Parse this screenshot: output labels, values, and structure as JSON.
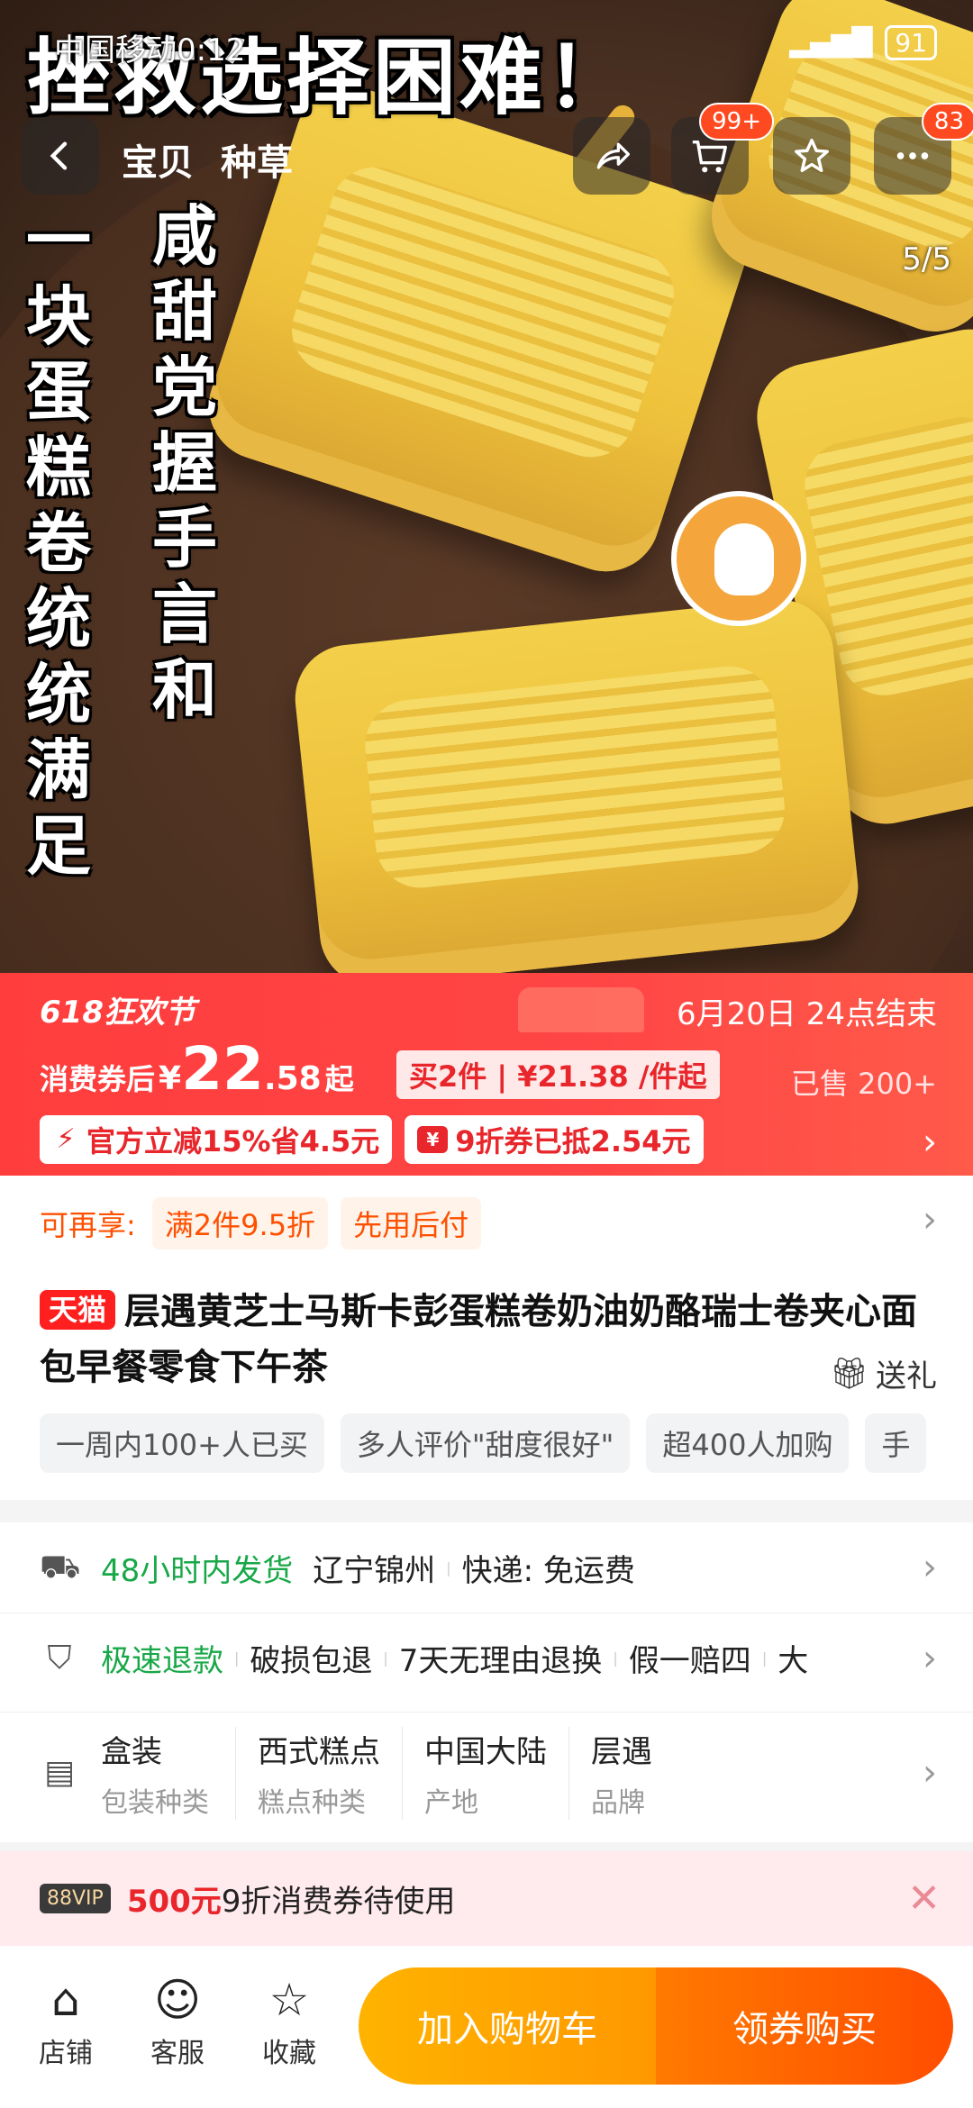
{
  "status_bar": {
    "carrier": "中国移动0:12",
    "battery": "91"
  },
  "hero": {
    "ad_title": "挫救选择困难！",
    "left_vertical": "一块蛋糕卷统统满足",
    "mid_vertical": "咸甜党握手言和",
    "counter": "5/5"
  },
  "nav": {
    "tab_item": "宝贝",
    "tab_grass": "种草",
    "cart_badge": "99+",
    "more_badge": "83"
  },
  "promo": {
    "festival": "618狂欢节",
    "end_time": "6月20日 24点结束",
    "price_label": "消费券后",
    "currency": "¥",
    "price_int": "22",
    "price_dec": ".58",
    "price_suffix": "起",
    "multi_buy": "买2件 | ¥21.38 /件起",
    "sold": "已售 200+",
    "chip_official": "官方立减15%省4.5元",
    "chip_coupon": "9折券已抵2.54元"
  },
  "info": {
    "benefits_label": "可再享:",
    "benefit_1": "满2件9.5折",
    "benefit_2": "先用后付",
    "tmall_tag": "天猫",
    "title": "层遇黄芝士马斯卡彭蛋糕卷奶油奶酪瑞士卷夹心面包早餐零食下午茶",
    "gift": "送礼",
    "social_1": "一周内100+人已买",
    "social_2": "多人评价\"甜度很好\"",
    "social_3": "超400人加购",
    "social_4": "手"
  },
  "service": {
    "ship_green": "48小时内发货",
    "ship_origin": "辽宁锦州",
    "ship_express": "快递: 免运费",
    "refund_green": "极速退款",
    "refund_1": "破损包退",
    "refund_2": "7天无理由退换",
    "refund_3": "假一赔四",
    "refund_4": "大",
    "attrs": [
      {
        "v": "盒装",
        "k": "包装种类"
      },
      {
        "v": "西式糕点",
        "k": "糕点种类"
      },
      {
        "v": "中国大陆",
        "k": "产地"
      },
      {
        "v": "层遇",
        "k": "品牌"
      }
    ]
  },
  "vip": {
    "badge": "88VIP",
    "amount": "500元",
    "text": "9折消费券待使用"
  },
  "bottom": {
    "shop": "店铺",
    "service": "客服",
    "collect": "收藏",
    "add_cart": "加入购物车",
    "buy": "领券购买"
  }
}
